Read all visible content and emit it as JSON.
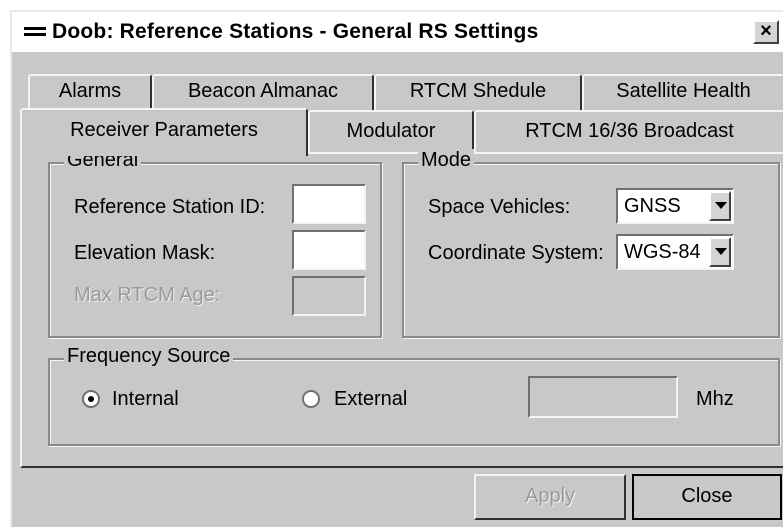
{
  "window": {
    "title": "Doob: Reference Stations - General RS Settings",
    "close_label": "×"
  },
  "tabs": {
    "back_row": [
      "Alarms",
      "Beacon Almanac",
      "RTCM Shedule",
      "Satellite Health"
    ],
    "front_row": [
      "Receiver Parameters",
      "Modulator",
      "RTCM 16/36 Broadcast"
    ],
    "active": "Receiver Parameters"
  },
  "general": {
    "title": "General",
    "reference_station_id_label": "Reference Station ID:",
    "reference_station_id_value": "",
    "elevation_mask_label": "Elevation Mask:",
    "elevation_mask_value": "",
    "max_rtcm_age_label": "Max RTCM Age:",
    "max_rtcm_age_value": ""
  },
  "mode": {
    "title": "Mode",
    "space_vehicles_label": "Space Vehicles:",
    "space_vehicles_value": "GNSS",
    "coordinate_system_label": "Coordinate System:",
    "coordinate_system_value": "WGS-84"
  },
  "frequency": {
    "title": "Frequency Source",
    "internal_label": "Internal",
    "external_label": "External",
    "selected": "Internal",
    "external_value": "",
    "unit": "Mhz"
  },
  "buttons": {
    "apply": "Apply",
    "close": "Close"
  }
}
